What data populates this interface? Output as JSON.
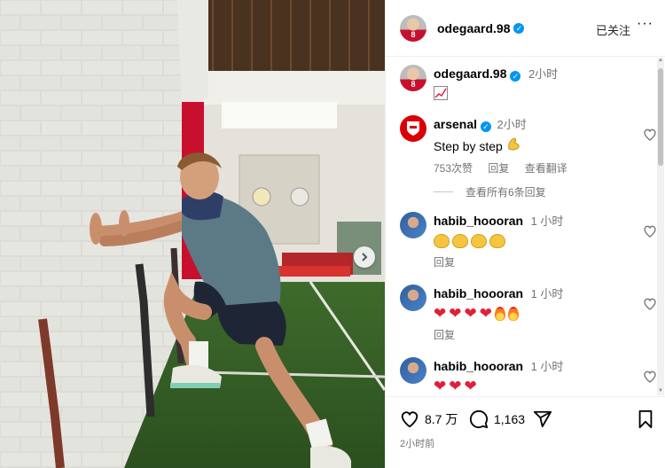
{
  "post": {
    "author": "odegaard.98",
    "jersey_number": "8",
    "follow_label": "已关注",
    "more_label": "···",
    "caption_time": "2小时",
    "caption_icon": "chart-emoji"
  },
  "comments": [
    {
      "user": "arsenal",
      "verified": true,
      "time": "2小时",
      "text": "Step by step",
      "text_emoji": "flexed-biceps",
      "likes": "753次赞",
      "reply": "回复",
      "translate": "查看翻译"
    },
    {
      "user": "habib_hoooran",
      "verified": false,
      "time": "1 小时",
      "emoji": [
        "clapping-hands",
        "clapping-hands",
        "clapping-hands",
        "clapping-hands"
      ],
      "reply": "回复"
    },
    {
      "user": "habib_hoooran",
      "verified": false,
      "time": "1 小时",
      "emoji": [
        "red-heart",
        "red-heart",
        "red-heart",
        "red-heart",
        "fire",
        "fire"
      ],
      "reply": "回复"
    },
    {
      "user": "habib_hoooran",
      "verified": false,
      "time": "1 小时",
      "emoji": [
        "red-heart",
        "red-heart",
        "red-heart"
      ]
    }
  ],
  "view_replies": "查看所有6条回复",
  "actions": {
    "likes": "8.7 万",
    "comments": "1,163"
  },
  "posted_time": "2小时前",
  "colors": {
    "verified": "#0095f6",
    "arsenal_red": "#db0007",
    "heart_red": "#e0203a",
    "muted": "#737373"
  }
}
